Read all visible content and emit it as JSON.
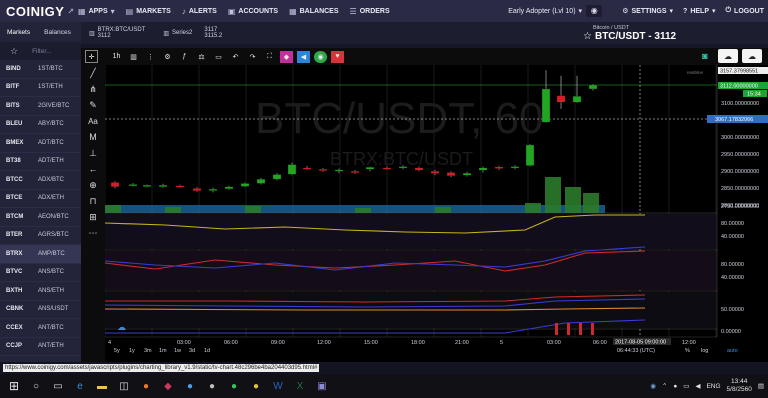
{
  "topnav": {
    "logo": "COINIGY",
    "items": [
      "APPS",
      "MARKETS",
      "ALERTS",
      "ACCOUNTS",
      "BALANCES",
      "ORDERS"
    ],
    "user": "Early Adopter (Lvl 10)",
    "right_items": [
      "SETTINGS",
      "HELP",
      "LOGOUT"
    ]
  },
  "sidebar": {
    "tabs": [
      "Markets",
      "Balances"
    ],
    "filter_placeholder": "Filter...",
    "rows": [
      {
        "exchange": "BIND",
        "pair": "1ST/BTC"
      },
      {
        "exchange": "BITF",
        "pair": "1ST/ETH"
      },
      {
        "exchange": "BITS",
        "pair": "2GIVE/BTC"
      },
      {
        "exchange": "BLEU",
        "pair": "ABY/BTC"
      },
      {
        "exchange": "BMEX",
        "pair": "ADT/BTC"
      },
      {
        "exchange": "BT38",
        "pair": "ADT/ETH"
      },
      {
        "exchange": "BTCC",
        "pair": "ADX/BTC"
      },
      {
        "exchange": "BTCE",
        "pair": "ADX/ETH"
      },
      {
        "exchange": "BTCM",
        "pair": "AEON/BTC"
      },
      {
        "exchange": "BTER",
        "pair": "AGRS/BTC"
      },
      {
        "exchange": "BTRX",
        "pair": "AMP/BTC"
      },
      {
        "exchange": "BTVC",
        "pair": "ANS/BTC"
      },
      {
        "exchange": "BXTH",
        "pair": "ANS/ETH"
      },
      {
        "exchange": "CBNK",
        "pair": "ANS/USDT"
      },
      {
        "exchange": "CCEX",
        "pair": "ANT/BTC"
      },
      {
        "exchange": "CCJP",
        "pair": "ANT/ETH"
      }
    ]
  },
  "chart_header": {
    "symbol": "BTRX:BTC/USDT",
    "symbol_sub": "3112",
    "series": "Series2",
    "price_top": "3117",
    "price_bottom": "3115.2"
  },
  "pair": {
    "subtitle": "Bitcoin / USDT",
    "title": "BTC/USDT - 3112"
  },
  "toolbar": {
    "interval": "1h"
  },
  "chart_data": {
    "type": "candlestick",
    "watermark": "BTC/USDT, 60",
    "watermark_sub": "BTRX:BTC/USDT",
    "x_labels": [
      "4",
      "03:00",
      "06:00",
      "09:00",
      "12:00",
      "15:00",
      "18:00",
      "21:00",
      "5",
      "03:00",
      "06:00",
      "12:00"
    ],
    "y_labels": [
      "3112.00000000",
      "3100.00000000",
      "3050.00000000",
      "3000.00000000",
      "2950.00000000",
      "2900.00000000",
      "2850.00000000",
      "2800.00000000",
      "2750.00000000"
    ],
    "last_price_tag": "3112.00000000",
    "last_price_sub": "15:34",
    "top_tag": "3157.37998551",
    "cursor_tag": "3067.17832066",
    "realtime_label": "realtime",
    "osc_labels": [
      "80.00000",
      "40.00000",
      "80.00000",
      "40.00000",
      "50.00000",
      "0.00000"
    ],
    "date_tag": "2017-08-05 09:00:00",
    "bottom_ranges": [
      "5y",
      "1y",
      "3m",
      "1m",
      "1w",
      "3d",
      "1d"
    ],
    "bottom_right": [
      "06:44:33 (UTC)",
      "%",
      "log",
      "auto"
    ]
  },
  "taskbar": {
    "url": "https://www.coinigy.com/assets/javascripts/plugins/charting_library_v1.9/static/tv-chart.48c296be4ba204403d95.html#",
    "lang": "ENG",
    "time": "13:44",
    "date": "5/8/2560"
  },
  "colors": {
    "up": "#22a521",
    "down": "#d71e26",
    "nav_bg": "#2b2a45"
  }
}
